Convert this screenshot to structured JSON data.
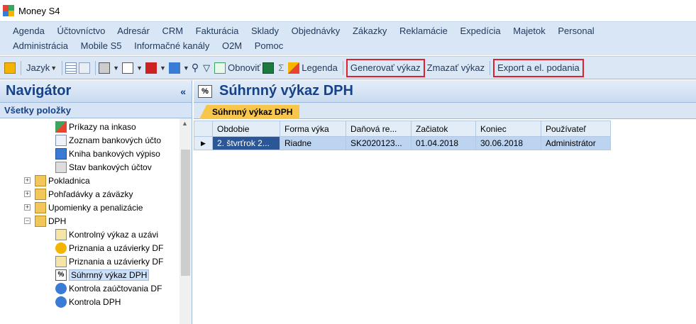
{
  "window": {
    "title": "Money S4"
  },
  "menu": {
    "row1": [
      "Agenda",
      "Účtovníctvo",
      "Adresár",
      "CRM",
      "Fakturácia",
      "Sklady",
      "Objednávky",
      "Zákazky",
      "Reklamácie",
      "Expedícia",
      "Majetok",
      "Personal"
    ],
    "row2": [
      "Administrácia",
      "Mobile S5",
      "Informačné kanály",
      "O2M",
      "Pomoc"
    ]
  },
  "toolbar": {
    "language": "Jazyk",
    "refresh": "Obnoviť",
    "sigma": "Σ",
    "legend": "Legenda",
    "generate": "Generovať výkaz",
    "delete": "Zmazať výkaz",
    "export": "Export a el. podania"
  },
  "navigator": {
    "title": "Navigátor",
    "collapse": "«",
    "subheader": "Všetky položky",
    "items": [
      "Príkazy na inkaso",
      "Zoznam bankových účto",
      "Kniha bankových výpiso",
      "Stav bankových účtov",
      "Pokladnica",
      "Pohľadávky a záväzky",
      "Upomienky a penalizácie",
      "DPH",
      "Kontrolný výkaz a uzávi",
      "Priznania a uzávierky DF",
      "Priznania a uzávierky DF",
      "Súhrnný výkaz DPH",
      "Kontrola zaúčtovania DF",
      "Kontrola DPH"
    ]
  },
  "main": {
    "title": "Súhrnný výkaz DPH",
    "tab": "Súhrnný výkaz DPH",
    "columns": [
      "Obdobie",
      "Forma výka",
      "Daňová re...",
      "Začiatok",
      "Koniec",
      "Používateľ"
    ],
    "rows": [
      [
        "2. štvrťrok 2...",
        "Riadne",
        "SK2020123...",
        "01.04.2018",
        "30.06.2018",
        "Administrátor"
      ]
    ]
  },
  "colors": {
    "accent": "#15428b",
    "highlight": "#d9232f",
    "tab": "#f7c64b"
  }
}
